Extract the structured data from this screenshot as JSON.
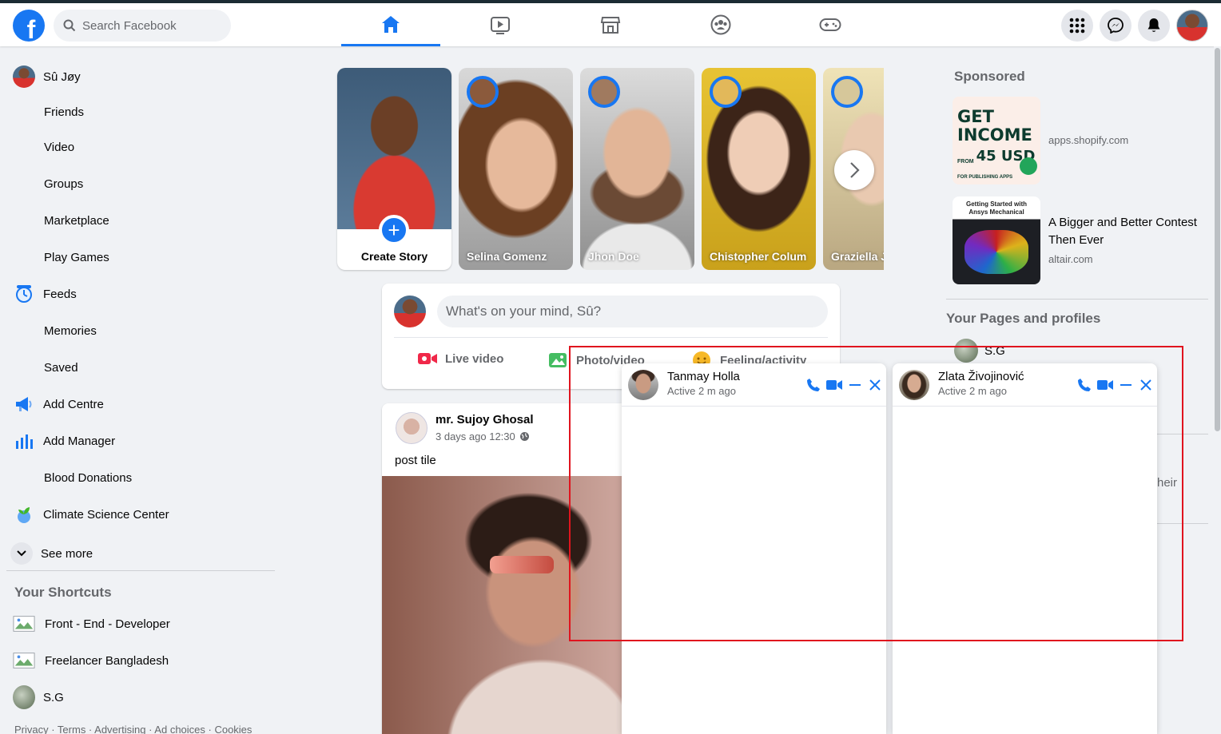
{
  "colors": {
    "brand": "#1877f2",
    "highlight": "#e0141e"
  },
  "header": {
    "logo_letter": "f",
    "search_placeholder": "Search Facebook",
    "nav": [
      "home-icon",
      "watch-icon",
      "marketplace-icon",
      "groups-icon",
      "gaming-icon"
    ],
    "actions": [
      "menu-grid-icon",
      "messenger-icon",
      "notifications-icon",
      "account-avatar"
    ]
  },
  "sidebar": {
    "items": [
      {
        "label": "Sû Jøy",
        "icon": "avatar"
      },
      {
        "label": "Friends"
      },
      {
        "label": "Video"
      },
      {
        "label": "Groups"
      },
      {
        "label": "Marketplace"
      },
      {
        "label": "Play Games"
      },
      {
        "label": "Feeds",
        "icon": "feeds-icon"
      },
      {
        "label": "Memories"
      },
      {
        "label": "Saved"
      },
      {
        "label": "Add Centre",
        "icon": "megaphone-icon"
      },
      {
        "label": "Add Manager",
        "icon": "bar-chart-icon"
      },
      {
        "label": "Blood Donations"
      },
      {
        "label": "Climate Science Center",
        "icon": "climate-icon"
      }
    ],
    "see_more": "See more",
    "shortcuts_title": "Your Shortcuts",
    "shortcuts": [
      {
        "label": "Front - End - Developer"
      },
      {
        "label": "Freelancer Bangladesh"
      },
      {
        "label": "S.G"
      }
    ],
    "footer": "Privacy · Terms · Advertising · Ad choices · Cookies"
  },
  "stories": {
    "create_label": "Create Story",
    "create_plus": "+",
    "items": [
      {
        "name": "Selina Gomenz"
      },
      {
        "name": "Jhon Doe"
      },
      {
        "name": "Chistopher Colum"
      },
      {
        "name": "Graziella Je"
      }
    ]
  },
  "composer": {
    "placeholder": "What's on your mind, Sû?",
    "actions": [
      "Live video",
      "Photo/video",
      "Feeling/activity"
    ]
  },
  "post": {
    "author": "mr. Sujoy Ghosal",
    "time": "3 days ago 12:30",
    "text": "post tile"
  },
  "right": {
    "sponsored_title": "Sponsored",
    "ads": [
      {
        "headline": "",
        "domain": "apps.shopify.com",
        "thumb_lines": [
          "GET",
          "INCOME",
          "FROM",
          "45 USD",
          "FOR PUBLISHING APPS"
        ]
      },
      {
        "headline": "A Bigger and Better Contest Then Ever",
        "domain": "altair.com",
        "thumb_lines": [
          "Getting Started with",
          "Ansys Mechanical"
        ]
      }
    ],
    "pages_title": "Your Pages and profiles",
    "pages": [
      {
        "label": "S.G"
      }
    ],
    "partial_text": "heir"
  },
  "chats": [
    {
      "name": "Tanmay Holla",
      "status": "Active 2 m ago"
    },
    {
      "name": "Zlata Živojinović",
      "status": "Active 2 m ago"
    }
  ]
}
